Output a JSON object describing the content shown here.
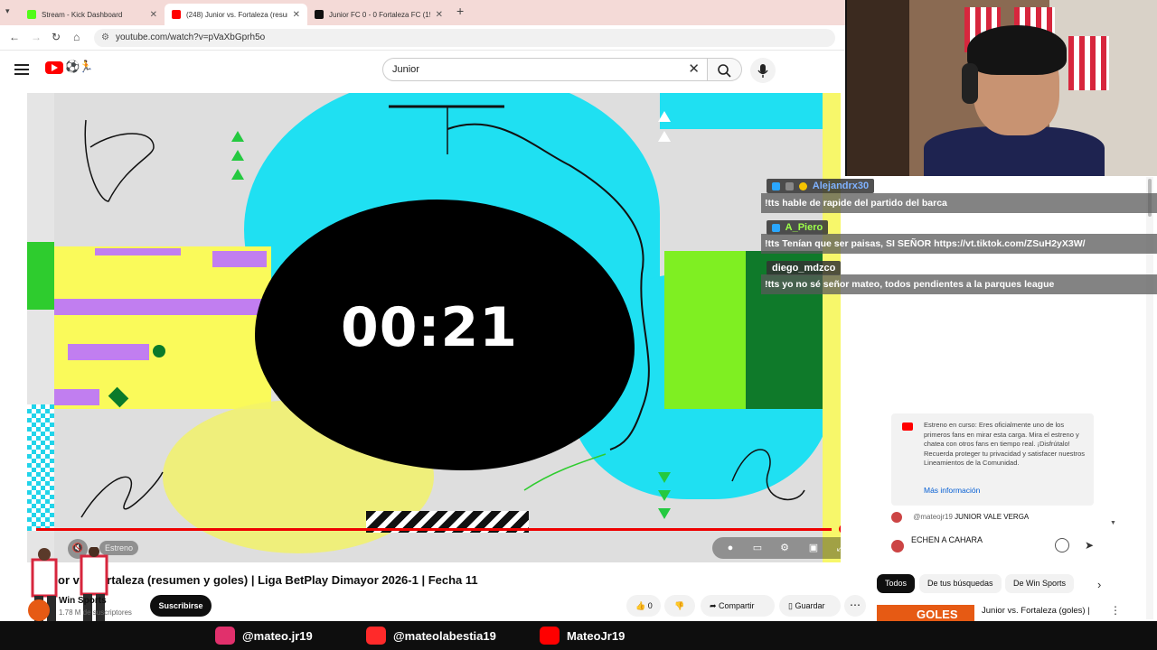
{
  "browser": {
    "tabs": [
      {
        "title": "Stream - Kick Dashboard",
        "active": false,
        "favicon_color": "#53fc18"
      },
      {
        "title": "(248) Junior vs. Fortaleza (resun",
        "active": true,
        "favicon_color": "#ff0000"
      },
      {
        "title": "Junior FC 0 - 0 Fortaleza FC (15",
        "active": false,
        "favicon_color": "#111111"
      }
    ],
    "url": "youtube.com/watch?v=pVaXbGprh5o"
  },
  "youtube": {
    "search_value": "Junior",
    "video": {
      "countdown": "00:21",
      "estreno_label": "Estreno",
      "title": "or vs. Fortaleza (resumen y goles) | Liga BetPlay Dimayor 2026-1 | Fecha 11"
    },
    "channel": {
      "name": "Win Sports",
      "subscribers": "1.78 M de suscriptores",
      "subscribe_label": "Suscribirse"
    },
    "actions": {
      "likes": "0",
      "share_label": "Compartir",
      "save_label": "Guardar"
    },
    "chat_notice": {
      "text": "Estreno en curso: Eres oficialmente uno de los primeros fans en mirar esta carga. Mira el estreno y chatea con otros fans en tiempo real. ¡Disfrútalo! Recuerda proteger tu privacidad y satisfacer nuestros Lineamientos de la Comunidad.",
      "link": "Más información"
    },
    "chat_message": {
      "user": "@mateojr19",
      "text": "JUNIOR VALE VERGA"
    },
    "chat_input_value": "ECHEN A CAHARA",
    "filter_chips": [
      "Todos",
      "De tus búsquedas",
      "De Win Sports"
    ],
    "recommendation": {
      "thumb_text": "GOLES",
      "title": "Junior vs. Fortaleza (goles) |"
    }
  },
  "stream_chat": [
    {
      "user": "Alejandrx30",
      "user_color": "#7fb2ff",
      "message": "!tts hable de rapide del partido del barca"
    },
    {
      "user": "A_Piero",
      "user_color": "#9dff4a",
      "message": "!tts Tenían que ser paisas, SI SEÑOR https://vt.tiktok.com/ZSuH2yX3W/"
    },
    {
      "user": "diego_mdzco",
      "user_color": "#ffffff",
      "message": "!tts yo no sé señor mateo, todos pendientes a la parques league"
    }
  ],
  "socials": [
    {
      "platform": "instagram",
      "handle": "@mateo.jr19",
      "color": "#e1306c"
    },
    {
      "platform": "x",
      "handle": "@mateolabestia19",
      "color": "#ff2a2a"
    },
    {
      "platform": "youtube",
      "handle": "MateoJr19",
      "color": "#ff0000"
    }
  ]
}
